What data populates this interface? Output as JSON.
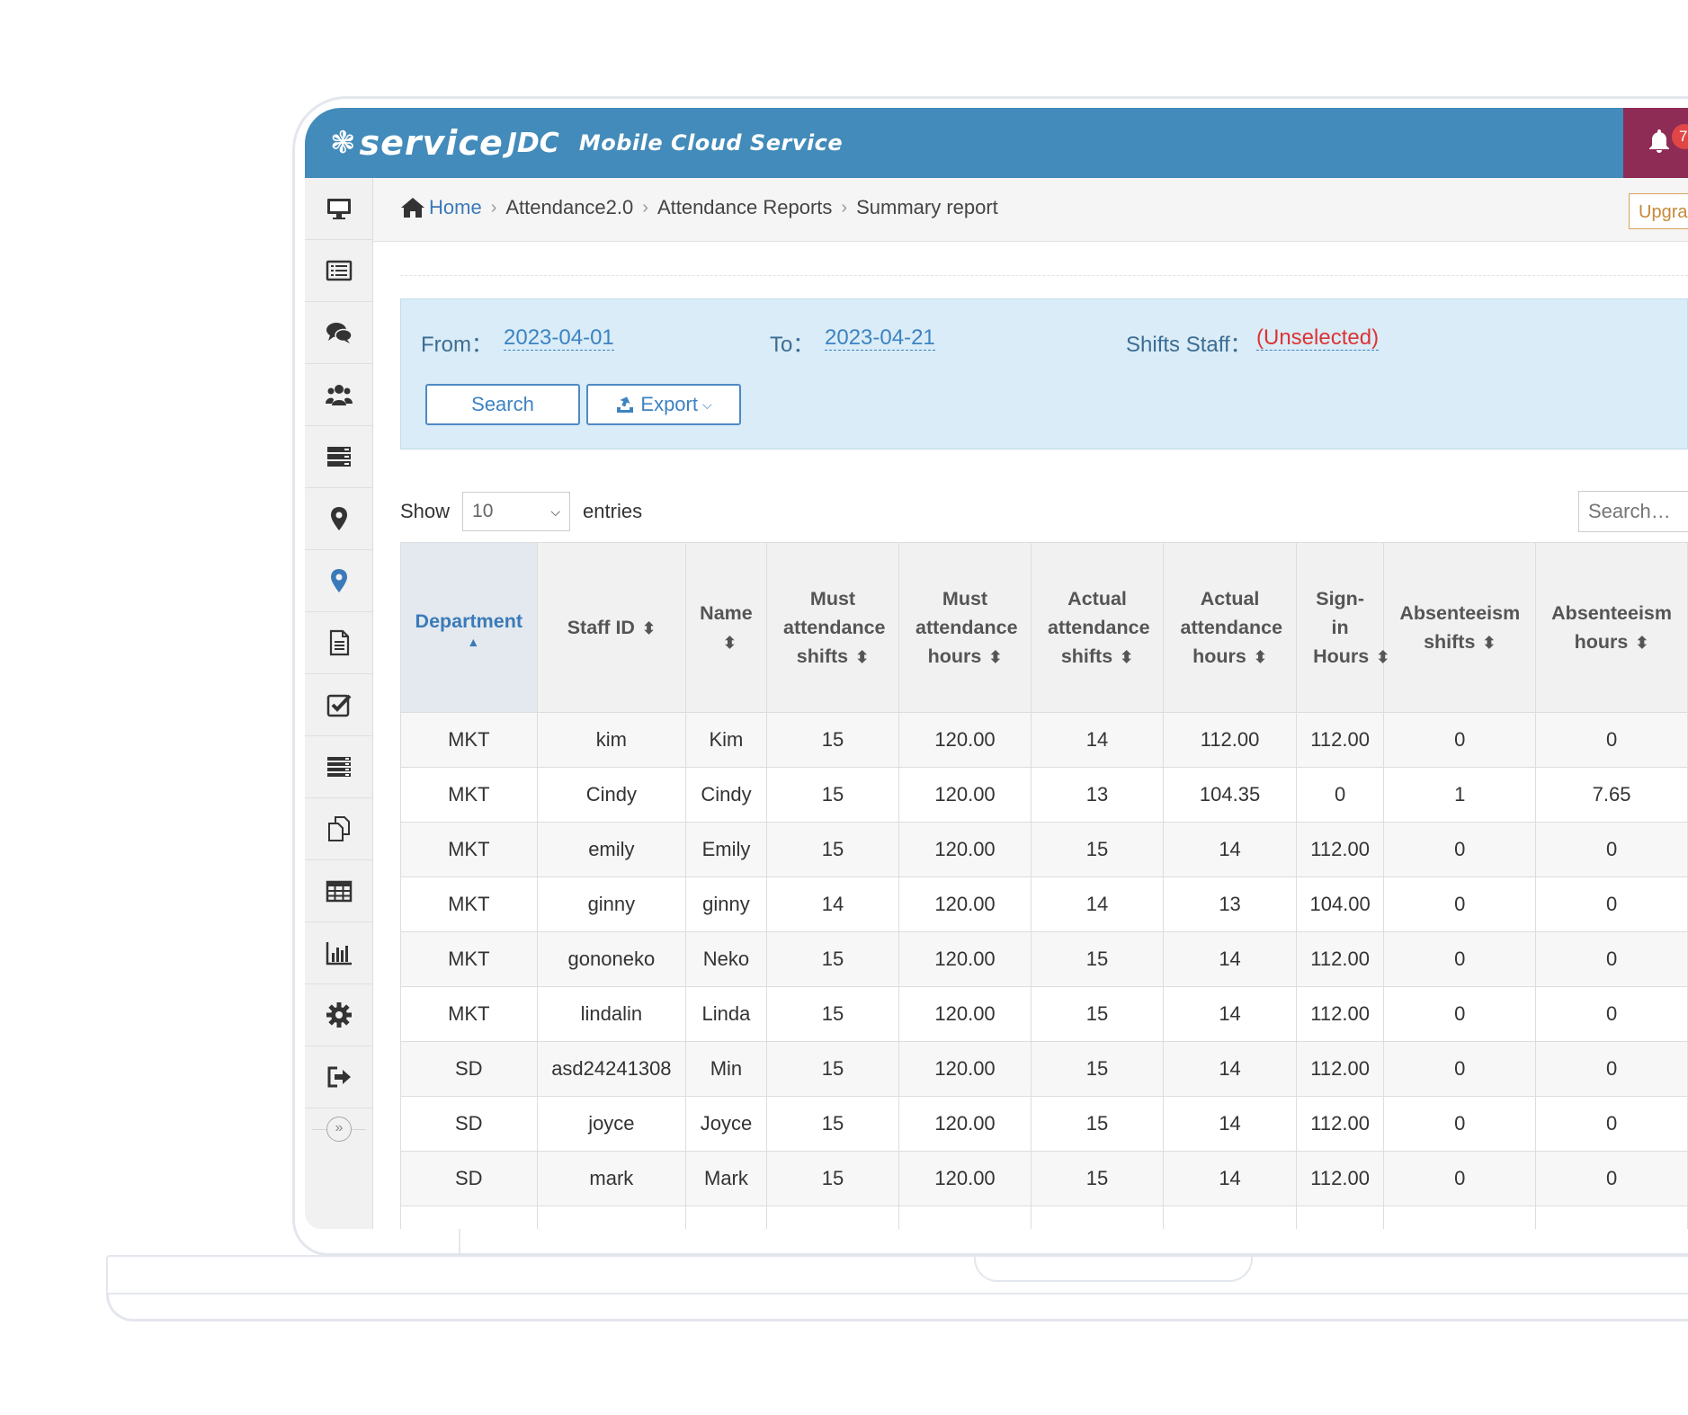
{
  "app": {
    "logo_mark": "❃",
    "logo_text": "service",
    "logo_jdc": "JDC",
    "logo_subtitle": "Mobile Cloud Service",
    "notification_count": "7",
    "upgrade_label": "Upgra"
  },
  "breadcrumb": {
    "home": "Home",
    "items": [
      "Attendance2.0",
      "Attendance Reports",
      "Summary report"
    ]
  },
  "filter": {
    "from_label": "From：",
    "from_value": "2023-04-01",
    "to_label": "To：",
    "to_value": "2023-04-21",
    "shifts_label": "Shifts Staff：",
    "shifts_value": "(Unselected)",
    "search_button": "Search",
    "export_button": "Export"
  },
  "table_controls": {
    "show_label": "Show",
    "page_size": "10",
    "entries_label": "entries",
    "search_placeholder": "Search…"
  },
  "table": {
    "columns": [
      {
        "key": "department",
        "label": "Department",
        "sorted": true
      },
      {
        "key": "staff_id",
        "label": "Staff ID"
      },
      {
        "key": "name",
        "label": "Name"
      },
      {
        "key": "must_shifts",
        "label": "Must attendance shifts"
      },
      {
        "key": "must_hours",
        "label": "Must attendance hours"
      },
      {
        "key": "actual_shifts",
        "label": "Actual attendance shifts"
      },
      {
        "key": "actual_hours",
        "label": "Actual attendance hours"
      },
      {
        "key": "signin_hours",
        "label": "Sign-in Hours"
      },
      {
        "key": "absent_shifts",
        "label": "Absenteeism shifts"
      },
      {
        "key": "absent_hours",
        "label": "Absenteeism hours"
      }
    ],
    "rows": [
      [
        "MKT",
        "kim",
        "Kim",
        "15",
        "120.00",
        "14",
        "112.00",
        "112.00",
        "0",
        "0"
      ],
      [
        "MKT",
        "Cindy",
        "Cindy",
        "15",
        "120.00",
        "13",
        "104.35",
        "0",
        "1",
        "7.65"
      ],
      [
        "MKT",
        "emily",
        "Emily",
        "15",
        "120.00",
        "15",
        "14",
        "112.00",
        "0",
        "0"
      ],
      [
        "MKT",
        "ginny",
        "ginny",
        "14",
        "120.00",
        "14",
        "13",
        "104.00",
        "0",
        "0"
      ],
      [
        "MKT",
        "gononeko",
        "Neko",
        "15",
        "120.00",
        "15",
        "14",
        "112.00",
        "0",
        "0"
      ],
      [
        "MKT",
        "lindalin",
        "Linda",
        "15",
        "120.00",
        "15",
        "14",
        "112.00",
        "0",
        "0"
      ],
      [
        "SD",
        "asd24241308",
        "Min",
        "15",
        "120.00",
        "15",
        "14",
        "112.00",
        "0",
        "0"
      ],
      [
        "SD",
        "joyce",
        "Joyce",
        "15",
        "120.00",
        "15",
        "14",
        "112.00",
        "0",
        "0"
      ],
      [
        "SD",
        "mark",
        "Mark",
        "15",
        "120.00",
        "15",
        "14",
        "112.00",
        "0",
        "0"
      ]
    ]
  },
  "sidebar": {
    "items": [
      "monitor-icon",
      "list-icon",
      "chat-icon",
      "group-icon",
      "server-icon",
      "map-marker-icon",
      "map-marker-active-icon",
      "document-icon",
      "checkbox-icon",
      "rows-icon",
      "copy-icon",
      "table-icon",
      "bar-chart-icon",
      "gear-icon",
      "sign-out-icon"
    ],
    "toggle": "»"
  },
  "colors": {
    "header": "#428bba",
    "notify": "#8e2c55",
    "filter_bg": "#d9ecf7",
    "link": "#3d83c2"
  }
}
